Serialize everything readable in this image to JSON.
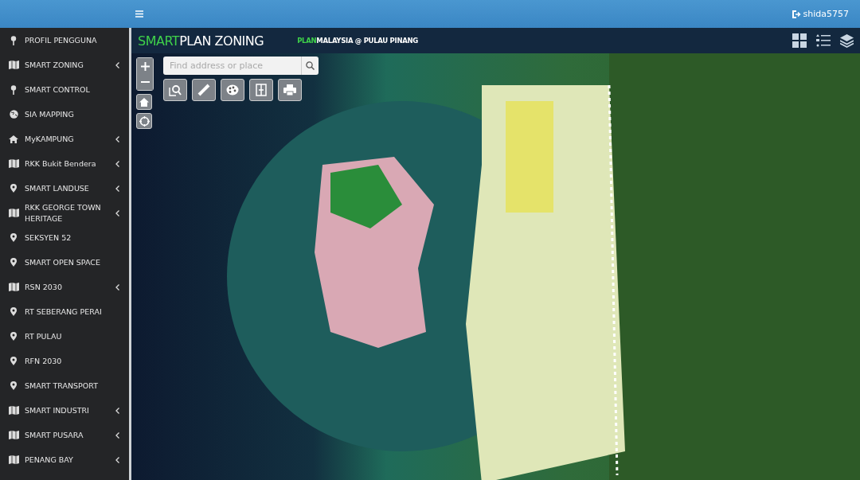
{
  "topbar": {
    "user": "shida5757"
  },
  "sidebar": {
    "items": [
      {
        "label": "PROFIL PENGGUNA",
        "kind": "pin",
        "expandable": false
      },
      {
        "label": "SMART ZONING",
        "kind": "map",
        "expandable": true
      },
      {
        "label": "SMART CONTROL",
        "kind": "pin",
        "expandable": false
      },
      {
        "label": "SIA MAPPING",
        "kind": "globe",
        "expandable": false
      },
      {
        "label": "MyKAMPUNG",
        "kind": "home",
        "expandable": true
      },
      {
        "label": "RKK Bukit Bendera",
        "kind": "map",
        "expandable": true
      },
      {
        "label": "SMART LANDUSE",
        "kind": "marker",
        "expandable": true
      },
      {
        "label": "RKK GEORGE TOWN HERITAGE",
        "kind": "map",
        "expandable": true
      },
      {
        "label": "SEKSYEN 52",
        "kind": "marker",
        "expandable": false
      },
      {
        "label": "SMART OPEN SPACE",
        "kind": "marker",
        "expandable": false
      },
      {
        "label": "RSN 2030",
        "kind": "map",
        "expandable": true
      },
      {
        "label": "RT SEBERANG PERAI",
        "kind": "marker",
        "expandable": false
      },
      {
        "label": "RT PULAU",
        "kind": "marker",
        "expandable": false
      },
      {
        "label": "RFN 2030",
        "kind": "marker",
        "expandable": false
      },
      {
        "label": "SMART TRANSPORT",
        "kind": "marker",
        "expandable": false
      },
      {
        "label": "SMART INDUSTRI",
        "kind": "map",
        "expandable": true
      },
      {
        "label": "SMART PUSARA",
        "kind": "map",
        "expandable": true
      },
      {
        "label": "PENANG BAY",
        "kind": "map",
        "expandable": true
      }
    ]
  },
  "header": {
    "title": [
      {
        "text": "SMART",
        "accent": true
      },
      {
        "text": "PLAN ZONING",
        "accent": false
      }
    ],
    "subtitle": [
      {
        "text": "PLAN",
        "accent": true
      },
      {
        "text": "MALAYSIA @ PULAU PINANG",
        "accent": false
      }
    ]
  },
  "search": {
    "placeholder": "Find address or place"
  }
}
